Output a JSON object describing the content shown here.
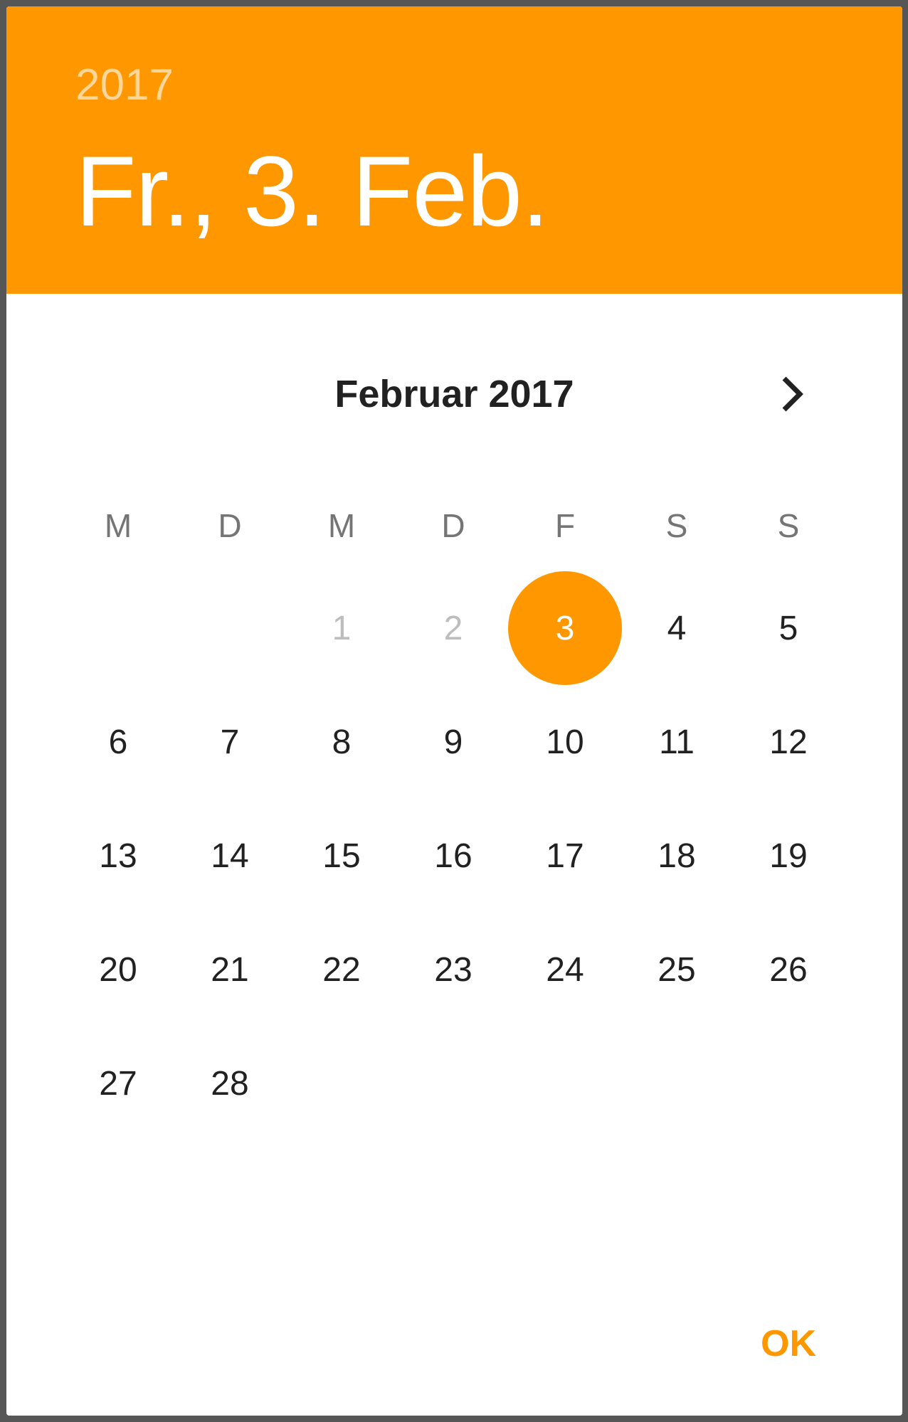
{
  "header": {
    "year": "2017",
    "date": "Fr., 3. Feb."
  },
  "calendar": {
    "month_title": "Februar 2017",
    "weekdays": [
      "M",
      "D",
      "M",
      "D",
      "F",
      "S",
      "S"
    ],
    "weeks": [
      [
        "",
        "",
        "1",
        "2",
        "3",
        "4",
        "5"
      ],
      [
        "6",
        "7",
        "8",
        "9",
        "10",
        "11",
        "12"
      ],
      [
        "13",
        "14",
        "15",
        "16",
        "17",
        "18",
        "19"
      ],
      [
        "20",
        "21",
        "22",
        "23",
        "24",
        "25",
        "26"
      ],
      [
        "27",
        "28",
        "",
        "",
        "",
        "",
        ""
      ]
    ],
    "selected_day": "3",
    "disabled_days": [
      "1",
      "2"
    ]
  },
  "actions": {
    "ok_label": "OK"
  },
  "icons": {
    "next": "chevron-right-icon"
  },
  "colors": {
    "accent": "#FF9800",
    "text": "#212121",
    "weekday_text": "#757575",
    "disabled_text": "#BDBDBD"
  }
}
